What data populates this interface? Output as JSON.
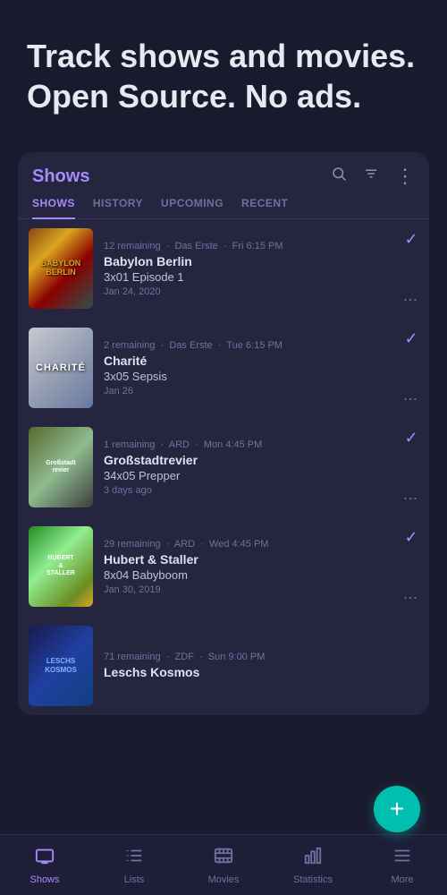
{
  "hero": {
    "title": "Track shows and movies. Open Source. No ads."
  },
  "card": {
    "title": "Shows",
    "tabs": [
      {
        "label": "SHOWS",
        "active": true
      },
      {
        "label": "HISTORY",
        "active": false
      },
      {
        "label": "UPCOMING",
        "active": false
      },
      {
        "label": "RECENT",
        "active": false
      }
    ],
    "shows": [
      {
        "id": "babylon-berlin",
        "remaining": "12 remaining",
        "channel": "Das Erste",
        "time": "Fri 6:15 PM",
        "name": "Babylon Berlin",
        "episode": "3x01 Episode 1",
        "date": "Jan 24, 2020",
        "poster_type": "babylon"
      },
      {
        "id": "charite",
        "remaining": "2 remaining",
        "channel": "Das Erste",
        "time": "Tue 6:15 PM",
        "name": "Charité",
        "episode": "3x05 Sepsis",
        "date": "Jan 26",
        "poster_type": "charite"
      },
      {
        "id": "grossstadtrevier",
        "remaining": "1 remaining",
        "channel": "ARD",
        "time": "Mon 4:45 PM",
        "name": "Großstadtrevier",
        "episode": "34x05 Prepper",
        "date": "3 days ago",
        "poster_type": "grossstadt"
      },
      {
        "id": "hubert-staller",
        "remaining": "29 remaining",
        "channel": "ARD",
        "time": "Wed 4:45 PM",
        "name": "Hubert & Staller",
        "episode": "8x04 Babyboom",
        "date": "Jan 30, 2019",
        "poster_type": "hubert"
      },
      {
        "id": "leschs-kosmos",
        "remaining": "71 remaining",
        "channel": "ZDF",
        "time": "Sun 9:00 PM",
        "name": "Leschs Kosmos",
        "episode": "",
        "date": "",
        "poster_type": "leschs"
      }
    ]
  },
  "fab": {
    "label": "+"
  },
  "bottom_nav": {
    "items": [
      {
        "id": "shows",
        "label": "Shows",
        "active": true
      },
      {
        "id": "lists",
        "label": "Lists",
        "active": false
      },
      {
        "id": "movies",
        "label": "Movies",
        "active": false
      },
      {
        "id": "statistics",
        "label": "Statistics",
        "active": false
      },
      {
        "id": "more",
        "label": "More",
        "active": false
      }
    ]
  },
  "poster_labels": {
    "babylon": "BABYLON\nBERLIN",
    "charite": "CHARITÉ",
    "grossstadt": "Großstadt\nrevier",
    "hubert": "HUBERT\n&\nSTALLER",
    "leschs": "LESCHS\nKOSMOS"
  }
}
